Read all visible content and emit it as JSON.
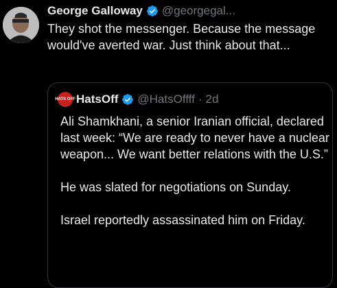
{
  "tweet": {
    "author_name": "George Galloway",
    "author_handle": "@georgegal...",
    "text": "They shot the messenger. Because the message would've averted war. Just think about that..."
  },
  "quoted_tweet": {
    "avatar_text": "HATS OFF",
    "author_name": "HatsOff",
    "author_handle": "@HatsOffff",
    "separator": "·",
    "time": "2d",
    "paragraphs": [
      "Ali Shamkhani, a senior Iranian official, declared last week: “We are ready to never have a nuclear weapon... We want better relations with the U.S.”",
      "He was slated for negotiations on Sunday.",
      "Israel reportedly assassinated him on Friday."
    ]
  },
  "colors": {
    "background": "#000000",
    "text": "#e7e9ea",
    "muted": "#71767b",
    "verified": "#1d9bf0",
    "border": "#2f3336"
  }
}
